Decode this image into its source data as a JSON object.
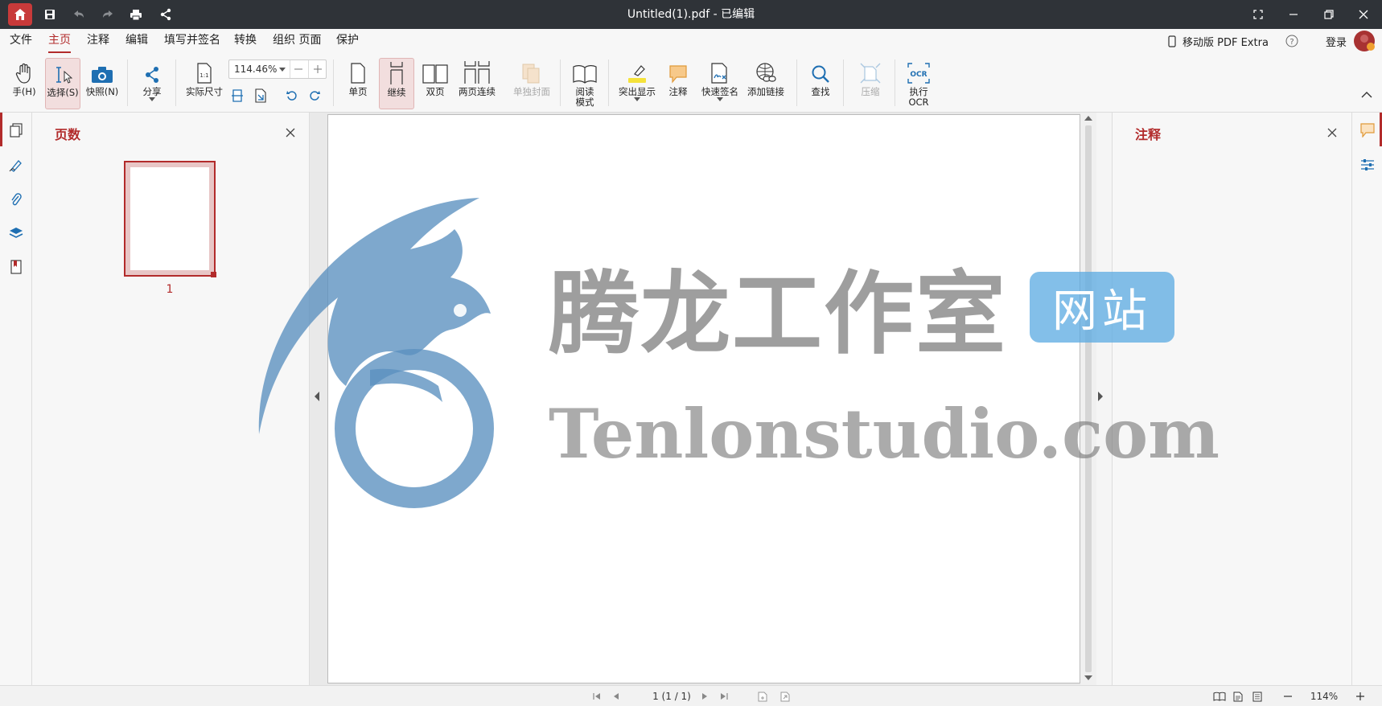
{
  "window": {
    "title": "Untitled(1).pdf - 已编辑"
  },
  "menu": {
    "items": [
      "文件",
      "主页",
      "注释",
      "编辑",
      "填写并签名",
      "转换",
      "组织 页面",
      "保护"
    ],
    "mobile_label": "移动版 PDF Extra",
    "login_label": "登录"
  },
  "ribbon": {
    "hand": "手(H)",
    "select": "选择(S)",
    "snapshot": "快照(N)",
    "share": "分享",
    "actual_size": "实际尺寸",
    "zoom_value": "114.46%",
    "single_page": "单页",
    "continuous": "继续",
    "two_page": "双页",
    "two_page_cont": "两页连续",
    "single_cover": "单独封面",
    "read_mode_1": "阅读",
    "read_mode_2": "模式",
    "highlight": "突出显示",
    "annotate": "注释",
    "quick_sign": "快速签名",
    "add_link": "添加链接",
    "find": "查找",
    "compress": "压缩",
    "ocr_1": "执行",
    "ocr_2": "OCR",
    "ocr_icon_text": "OCR",
    "actual_size_icon_text": "1:1"
  },
  "left_panel": {
    "title": "页数",
    "thumb_label": "1"
  },
  "right_panel": {
    "title": "注释"
  },
  "status": {
    "page_indicator": "1 (1 / 1)",
    "zoom": "114%"
  },
  "watermark": {
    "cn": "腾龙工作室",
    "badge": "网站",
    "en": "Tenlonstudio.com"
  },
  "colors": {
    "accent": "#b22b2b",
    "titlebar": "#2f3338",
    "watermark_blue": "#5a8fbf"
  }
}
